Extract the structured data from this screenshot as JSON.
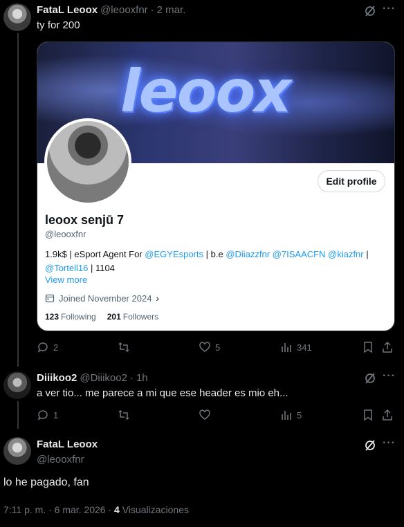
{
  "tweet1": {
    "name": "FataL Leoox",
    "handle": "@leooxfnr",
    "sep": "·",
    "time": "2 mar.",
    "text": "ty for 200",
    "card": {
      "banner_text": "leoox",
      "edit_label": "Edit profile",
      "name": "leoox senjū 7",
      "handle": "@leooxfnr",
      "bio_a": "1.9k$ | eSport Agent For ",
      "bio_l1": "@EGYEsports",
      "bio_b": " | b.e ",
      "bio_l2": "@Diiazzfnr",
      "bio_c": " ",
      "bio_l3": "@7ISAACFN",
      "bio_d": " ",
      "bio_l4": "@kiazfnr",
      "bio_e": " |",
      "bio_l5": "@Tortell16",
      "bio_f": " | 1104",
      "view_more": "View more",
      "joined": "Joined November 2024",
      "following_count": "123",
      "following_label": "Following",
      "followers_count": "201",
      "followers_label": "Followers"
    },
    "actions": {
      "replies": "2",
      "retweets": "",
      "likes": "5",
      "views": "341"
    }
  },
  "tweet2": {
    "name": "Diiikoo2",
    "handle": "@Diiikoo2",
    "sep": "·",
    "time": "1h",
    "text": "a ver tio... me parece a mi que ese header es mio eh...",
    "actions": {
      "replies": "1",
      "retweets": "",
      "likes": "",
      "views": "5"
    }
  },
  "main": {
    "name": "FataL Leoox",
    "handle": "@leooxfnr",
    "text": "lo he pagado, fan",
    "meta_time": "7:11 p. m. · 6 mar. 2026 · ",
    "views_count": "4",
    "views_label": " Visualizaciones"
  },
  "icons": {
    "more": "more-icon",
    "grok": "grok-icon",
    "reply": "reply-icon",
    "retweet": "retweet-icon",
    "like": "heart-icon",
    "views": "views-icon",
    "bookmark": "bookmark-icon",
    "share": "share-icon",
    "calendar": "calendar-icon"
  },
  "colors": {
    "link": "#1d9bf0",
    "muted": "#71767b",
    "text": "#e7e9ea",
    "background": "#000000"
  }
}
